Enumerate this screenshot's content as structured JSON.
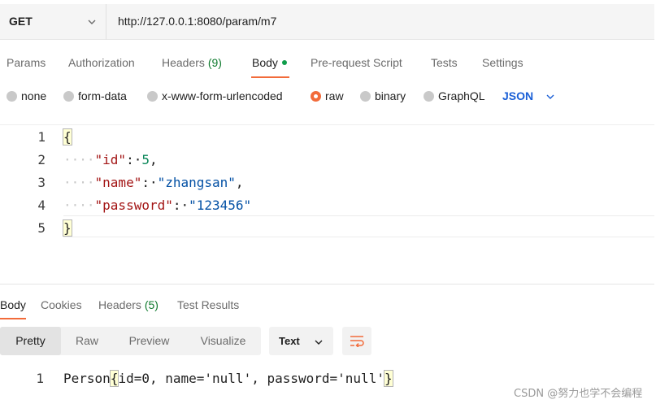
{
  "request": {
    "method": "GET",
    "url": "http://127.0.0.1:8080/param/m7"
  },
  "request_tabs": [
    {
      "label": "Params"
    },
    {
      "label": "Authorization"
    },
    {
      "label": "Headers",
      "count": "(9)"
    },
    {
      "label": "Body",
      "active": true
    },
    {
      "label": "Pre-request Script"
    },
    {
      "label": "Tests"
    },
    {
      "label": "Settings"
    }
  ],
  "body_types": {
    "options": [
      "none",
      "form-data",
      "x-www-form-urlencoded",
      "raw",
      "binary",
      "GraphQL"
    ],
    "selected": "raw",
    "format": "JSON"
  },
  "request_body": {
    "line_numbers": [
      "1",
      "2",
      "3",
      "4",
      "5"
    ],
    "open_brace": "{",
    "close_brace": "}",
    "fields": [
      {
        "key": "\"id\"",
        "value": "5",
        "trail": ","
      },
      {
        "key": "\"name\"",
        "value": "\"zhangsan\"",
        "trail": ","
      },
      {
        "key": "\"password\"",
        "value": "\"123456\"",
        "trail": ""
      }
    ]
  },
  "response_tabs": [
    {
      "label": "Body",
      "active": true
    },
    {
      "label": "Cookies"
    },
    {
      "label": "Headers",
      "count": "(5)"
    },
    {
      "label": "Test Results"
    }
  ],
  "response_view": {
    "modes": [
      "Pretty",
      "Raw",
      "Preview",
      "Visualize"
    ],
    "active": "Pretty",
    "format": "Text"
  },
  "response_body": {
    "line_number": "1",
    "prefix": "Person",
    "open_brace": "{",
    "content": "id=0, name='null', password='null'",
    "close_brace": "}"
  },
  "watermark": "CSDN @努力也学不会编程",
  "colors": {
    "accent": "#f26b3a",
    "link": "#1a5fd6",
    "json_key": "#a31515",
    "json_string": "#0451a5",
    "json_number": "#098658"
  }
}
